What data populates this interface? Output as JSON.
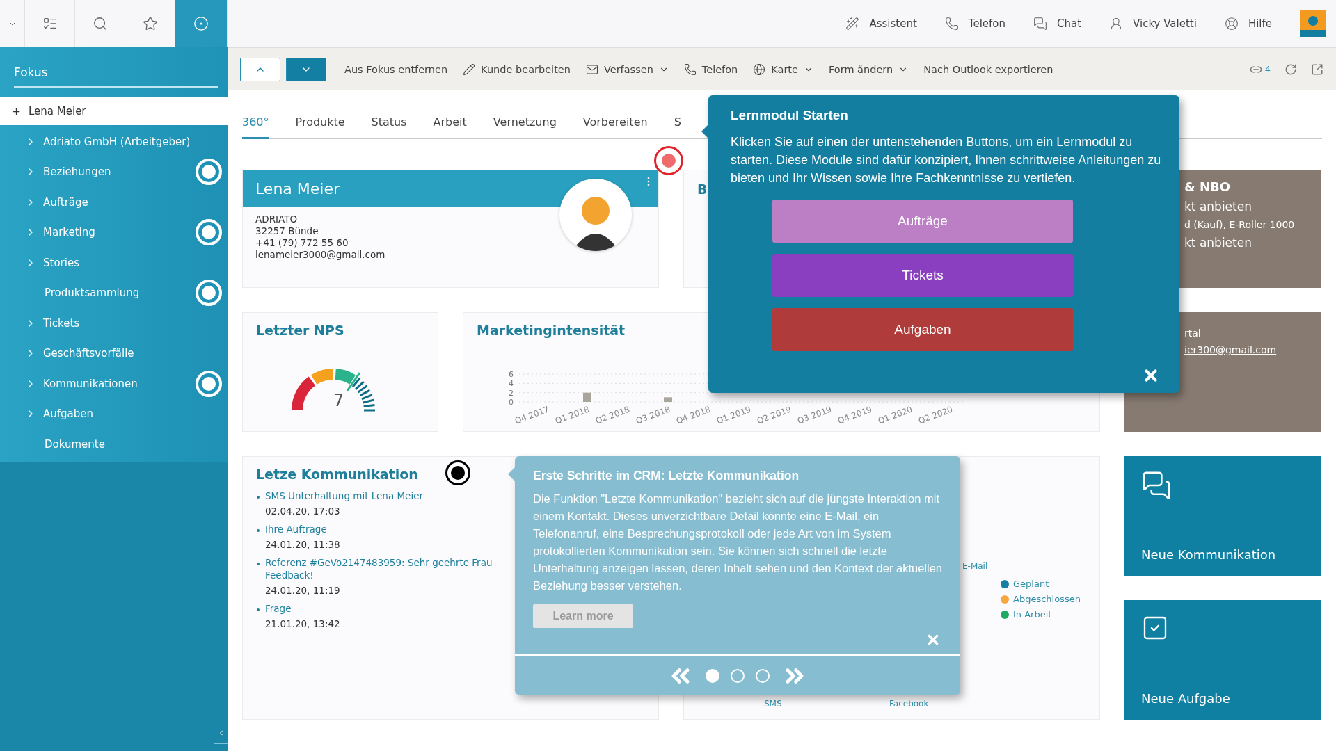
{
  "sidebar": {
    "icons": [
      {
        "kind": "dropdown",
        "selected": false
      },
      {
        "kind": "list",
        "selected": false
      },
      {
        "kind": "search",
        "selected": false
      },
      {
        "kind": "star",
        "selected": false
      },
      {
        "kind": "focus",
        "selected": true
      }
    ],
    "section_title": "Fokus",
    "pinned": "Lena Meier",
    "items": [
      {
        "label": "Adriato GmbH (Arbeitgeber)",
        "expandable": true,
        "marker": false
      },
      {
        "label": "Beziehungen",
        "expandable": true,
        "marker": true
      },
      {
        "label": "Aufträge",
        "expandable": true,
        "marker": false
      },
      {
        "label": "Marketing",
        "expandable": true,
        "marker": true
      },
      {
        "label": "Stories",
        "expandable": true,
        "marker": false
      },
      {
        "label": "Produktsammlung",
        "expandable": false,
        "marker": true
      },
      {
        "label": "Tickets",
        "expandable": true,
        "marker": false
      },
      {
        "label": "Geschäftsvorfälle",
        "expandable": true,
        "marker": false
      },
      {
        "label": "Kommunikationen",
        "expandable": true,
        "marker": true
      },
      {
        "label": "Aufgaben",
        "expandable": true,
        "marker": false
      },
      {
        "label": "Dokumente",
        "expandable": false,
        "marker": false
      }
    ]
  },
  "topbar": {
    "items": [
      {
        "kind": "assistant",
        "label": "Assistent"
      },
      {
        "kind": "phone",
        "label": "Telefon"
      },
      {
        "kind": "chat",
        "label": "Chat"
      },
      {
        "kind": "user",
        "label": "Vicky Valetti"
      },
      {
        "kind": "help",
        "label": "Hilfe"
      }
    ]
  },
  "toolbar": {
    "actions": [
      {
        "kind": "plain",
        "label": "Aus Fokus entfernen",
        "dropdown": false
      },
      {
        "kind": "edit",
        "label": "Kunde bearbeiten",
        "dropdown": false
      },
      {
        "kind": "mail",
        "label": "Verfassen",
        "dropdown": true
      },
      {
        "kind": "phone",
        "label": "Telefon",
        "dropdown": false
      },
      {
        "kind": "globe",
        "label": "Karte",
        "dropdown": true
      },
      {
        "kind": "plain",
        "label": "Form ändern",
        "dropdown": true
      },
      {
        "kind": "plain",
        "label": "Nach Outlook exportieren",
        "dropdown": false
      }
    ],
    "link_count": "4"
  },
  "tabs": [
    {
      "label": "360°",
      "selected": true
    },
    {
      "label": "Produkte",
      "selected": false
    },
    {
      "label": "Status",
      "selected": false
    },
    {
      "label": "Arbeit",
      "selected": false
    },
    {
      "label": "Vernetzung",
      "selected": false
    },
    {
      "label": "Vorbereiten",
      "selected": false
    },
    {
      "label": "S",
      "selected": false
    }
  ],
  "contact_card": {
    "name": "Lena Meier",
    "lines": [
      "ADRIATO",
      "32257 Bünde",
      "+41 (79) 772 55 60",
      "lenameier3000@gmail.com"
    ]
  },
  "card_b": {
    "title": "B"
  },
  "nbo_card": {
    "title": "& NBO",
    "lines": [
      "kt anbieten",
      "d (Kauf), E-Roller 1000",
      "kt anbieten"
    ]
  },
  "portal_card": {
    "text": "rtal",
    "link": "ier300@gmail.com"
  },
  "nps": {
    "title": "Letzter NPS",
    "value": "7"
  },
  "marketing": {
    "title": "Marketingintensität",
    "chart_data": {
      "type": "bar",
      "categories": [
        "Q4 2017",
        "Q1 2018",
        "Q2 2018",
        "Q3 2018",
        "Q4 2018",
        "Q1 2019",
        "Q2 2019",
        "Q3 2019",
        "Q4 2019",
        "Q1 2020",
        "Q2 2020"
      ],
      "values": [
        0,
        2,
        0,
        1,
        0,
        0,
        0,
        0,
        0,
        0,
        0
      ],
      "ylim": [
        0,
        6
      ],
      "yticks": [
        0,
        2,
        4,
        6
      ]
    }
  },
  "communications": {
    "title": "Letze Kommunikation",
    "items": [
      {
        "link": "SMS Unterhaltung mit Lena Meier",
        "date": "02.04.20, 17:03"
      },
      {
        "link": "Ihre Auftrage",
        "date": "24.01.20, 11:38"
      },
      {
        "link": "Referenz #GeVo2147483959: Sehr geehrte Frau",
        "continued": "Feedback!",
        "date": "24.01.20, 11:19"
      },
      {
        "link": "Frage",
        "date": "21.01.20, 13:42"
      }
    ]
  },
  "profile": {
    "axis_labels": [
      "E-Mail",
      "SMS",
      "Facebook"
    ],
    "legend": [
      {
        "label": "Geplant",
        "color": "#167fa3"
      },
      {
        "label": "Abgeschlossen",
        "color": "#f5a742"
      },
      {
        "label": "In Arbeit",
        "color": "#1fa864"
      }
    ]
  },
  "quick_actions": [
    {
      "kind": "communication",
      "label": "Neue Kommunikation"
    },
    {
      "kind": "task",
      "label": "Neue Aufgabe"
    }
  ],
  "learn_popup": {
    "title": "Lernmodul Starten",
    "text": "Klicken Sie auf einen der untenstehenden Buttons, um ein Lernmodul zu starten. Diese Module sind dafür konzipiert, Ihnen schrittweise Anleitungen zu bieten und Ihr Wissen sowie Ihre Fachkenntnisse zu vertiefen.",
    "buttons": [
      {
        "label": "Aufträge",
        "color": "#bc7ec4"
      },
      {
        "label": "Tickets",
        "color": "#8a3fc0"
      },
      {
        "label": "Aufgaben",
        "color": "#b03b3b"
      }
    ]
  },
  "tour_popup": {
    "title": "Erste Schritte im CRM: Letzte Kommunikation",
    "text": "Die Funktion \"Letzte Kommunikation\" bezieht sich auf die jüngste Interaktion mit einem Kontakt. Dieses unverzichtbare Detail könnte eine E-Mail, ein Telefonanruf, eine Besprechungsprotokoll oder jede Art von im System protokollierten Kommunikation sein. Sie können sich schnell die letzte Unterhaltung anzeigen lassen, deren Inhalt sehen und den Kontext der aktuellen Beziehung besser verstehen.",
    "button": "Learn more",
    "steps": [
      {
        "selected": true
      },
      {
        "selected": false
      },
      {
        "selected": false
      }
    ]
  }
}
